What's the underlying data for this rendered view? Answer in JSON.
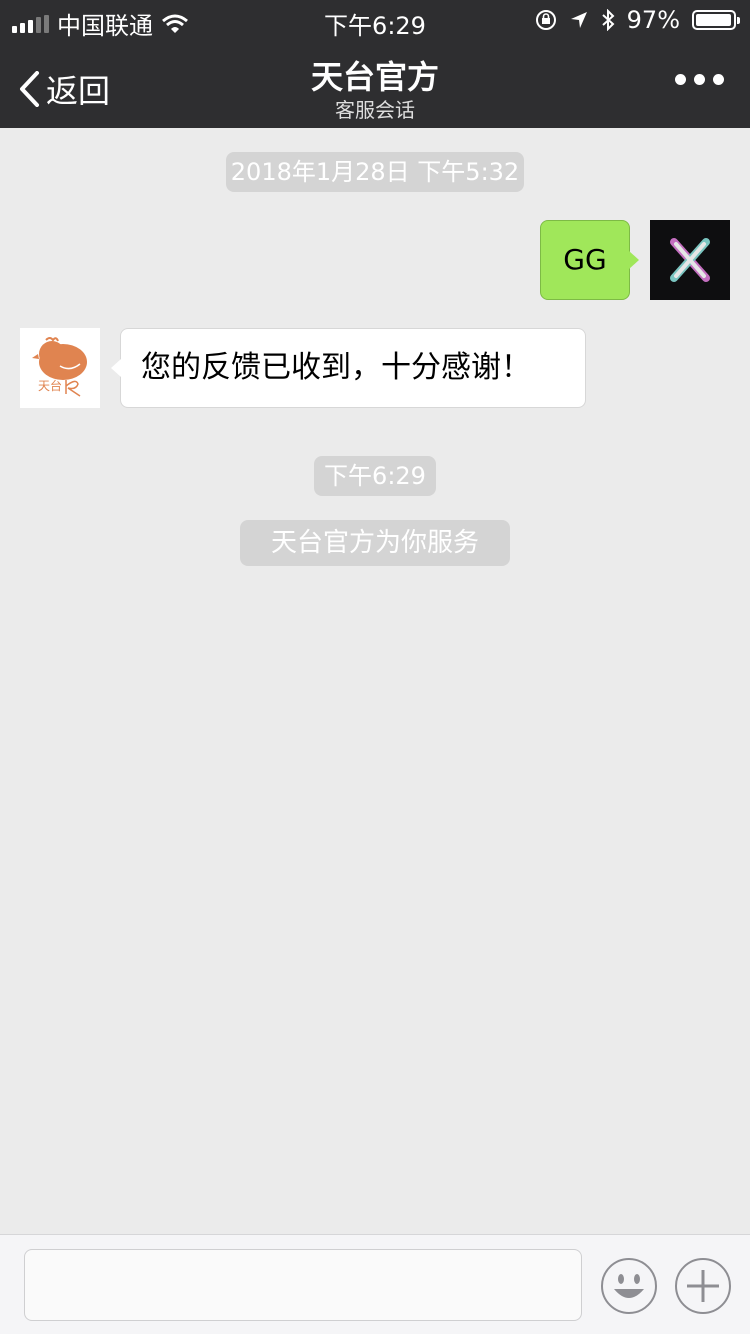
{
  "status_bar": {
    "carrier": "中国联通",
    "time": "下午6:29",
    "battery": "97%",
    "battery_level": 0.97,
    "icons": [
      "signal-icon",
      "wifi-icon",
      "orientation-lock-icon",
      "location-arrow-icon",
      "bluetooth-icon",
      "battery-icon"
    ]
  },
  "nav": {
    "back_label": "返回",
    "title": "天台官方",
    "subtitle": "客服会话",
    "more_icon": "more-dots-icon"
  },
  "chat": {
    "timestamp_1": "2018年1月28日 下午5:32",
    "sent_message": "GG",
    "received_message": "您的反馈已收到，十分感谢！",
    "timestamp_2": "下午6:29",
    "system_notice": "天台官方为你服务"
  },
  "input_bar": {
    "placeholder": "",
    "emoji_icon": "emoji-icon",
    "plus_icon": "plus-icon"
  },
  "colors": {
    "nav_bg": "#2e2e30",
    "chat_bg": "#ebebeb",
    "sent_bubble": "#a0e75a",
    "pill_bg": "#d4d4d4",
    "logo_orange": "#e08450"
  }
}
